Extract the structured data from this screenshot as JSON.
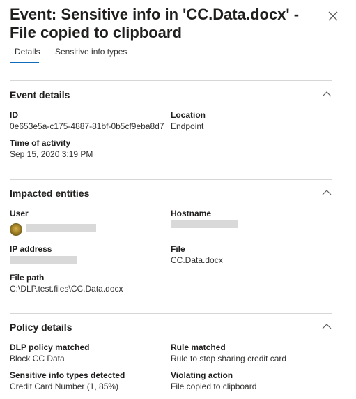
{
  "panel": {
    "title": "Event: Sensitive info in 'CC.Data.docx' - File copied to clipboard",
    "close_icon": "close-icon"
  },
  "tabs": [
    {
      "label": "Details",
      "active": true
    },
    {
      "label": "Sensitive info types",
      "active": false
    }
  ],
  "colors": {
    "accent": "#0f6cbd",
    "divider": "#d6d6d6",
    "redacted": "#d9d9d9"
  },
  "event_details": {
    "title": "Event details",
    "id_label": "ID",
    "id_value": "0e653e5a-c175-4887-81bf-0b5cf9eba8d7",
    "location_label": "Location",
    "location_value": "Endpoint",
    "time_label": "Time of activity",
    "time_value": "Sep 15, 2020 3:19 PM"
  },
  "impacted_entities": {
    "title": "Impacted entities",
    "user_label": "User",
    "hostname_label": "Hostname",
    "ip_label": "IP address",
    "file_label": "File",
    "file_value": "CC.Data.docx",
    "filepath_label": "File path",
    "filepath_value": "C:\\DLP.test.files\\CC.Data.docx"
  },
  "policy_details": {
    "title": "Policy details",
    "dlp_label": "DLP policy matched",
    "dlp_value": "Block CC Data",
    "rule_label": "Rule matched",
    "rule_value": "Rule to stop sharing credit card",
    "sit_label": "Sensitive info types detected",
    "sit_value": "Credit Card Number (1, 85%)",
    "action_label": "Violating action",
    "action_value": "File copied to clipboard"
  }
}
